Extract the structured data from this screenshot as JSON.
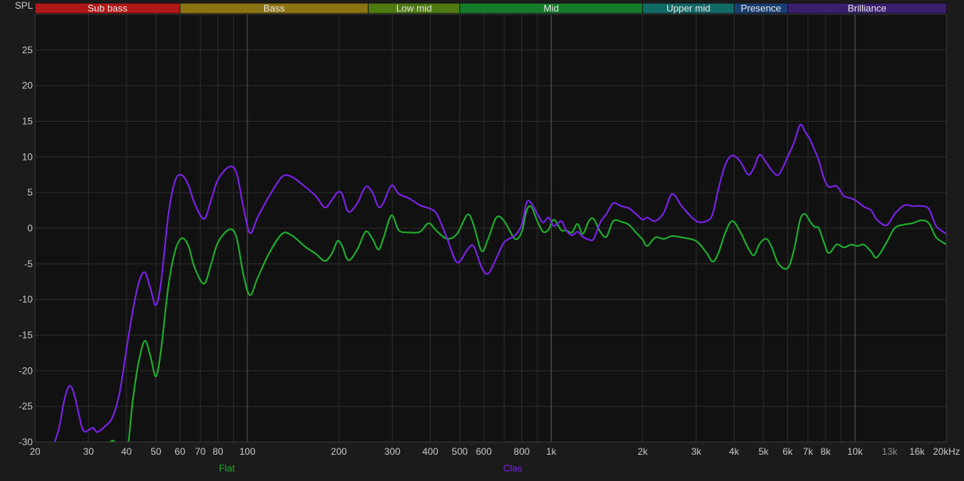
{
  "chart_data": {
    "type": "line",
    "title": "",
    "ylabel": "SPL",
    "xlabel": "",
    "x_scale": "log",
    "xlim": [
      20,
      20000
    ],
    "ylim": [
      -30,
      30
    ],
    "grid": true,
    "colors": {
      "background": "#1b1b1b",
      "plot_background": "#111111",
      "grid": "#2c2c2c",
      "major_grid": "#555555",
      "axis_text": "#c8c8c8",
      "muted_text": "#8a8a8a"
    },
    "yticks": [
      {
        "value": 25,
        "label": "25"
      },
      {
        "value": 20,
        "label": "20"
      },
      {
        "value": 15,
        "label": "15"
      },
      {
        "value": 10,
        "label": "10"
      },
      {
        "value": 5,
        "label": "5"
      },
      {
        "value": 0,
        "label": "0"
      },
      {
        "value": -5,
        "label": "-5"
      },
      {
        "value": -10,
        "label": "-10"
      },
      {
        "value": -15,
        "label": "-15"
      },
      {
        "value": -20,
        "label": "-20"
      },
      {
        "value": -25,
        "label": "-25"
      },
      {
        "value": -30,
        "label": "-30"
      }
    ],
    "xticks": [
      {
        "value": 20,
        "label": "20",
        "muted": false
      },
      {
        "value": 30,
        "label": "30",
        "muted": false
      },
      {
        "value": 40,
        "label": "40",
        "muted": false
      },
      {
        "value": 50,
        "label": "50",
        "muted": false
      },
      {
        "value": 60,
        "label": "60",
        "muted": false
      },
      {
        "value": 70,
        "label": "70",
        "muted": false
      },
      {
        "value": 80,
        "label": "80",
        "muted": false
      },
      {
        "value": 100,
        "label": "100",
        "muted": false
      },
      {
        "value": 200,
        "label": "200",
        "muted": false
      },
      {
        "value": 300,
        "label": "300",
        "muted": false
      },
      {
        "value": 400,
        "label": "400",
        "muted": false
      },
      {
        "value": 500,
        "label": "500",
        "muted": false
      },
      {
        "value": 600,
        "label": "600",
        "muted": false
      },
      {
        "value": 800,
        "label": "800",
        "muted": false
      },
      {
        "value": 1000,
        "label": "1k",
        "muted": false
      },
      {
        "value": 2000,
        "label": "2k",
        "muted": false
      },
      {
        "value": 3000,
        "label": "3k",
        "muted": false
      },
      {
        "value": 4000,
        "label": "4k",
        "muted": false
      },
      {
        "value": 5000,
        "label": "5k",
        "muted": false
      },
      {
        "value": 6000,
        "label": "6k",
        "muted": false
      },
      {
        "value": 7000,
        "label": "7k",
        "muted": false
      },
      {
        "value": 8000,
        "label": "8k",
        "muted": false
      },
      {
        "value": 10000,
        "label": "10k",
        "muted": false
      },
      {
        "value": 13000,
        "label": "13k",
        "muted": true
      },
      {
        "value": 16000,
        "label": "16k",
        "muted": false
      },
      {
        "value": 20000,
        "label": "20kHz",
        "muted": false
      }
    ],
    "major_gridlines_x": [
      100,
      1000,
      10000
    ],
    "bands": [
      {
        "name": "Sub bass",
        "from": 20,
        "to": 60,
        "color": "#b01818"
      },
      {
        "name": "Bass",
        "from": 60,
        "to": 250,
        "color": "#8c7412"
      },
      {
        "name": "Low mid",
        "from": 250,
        "to": 500,
        "color": "#4f7a12"
      },
      {
        "name": "Mid",
        "from": 500,
        "to": 2000,
        "color": "#157a2a"
      },
      {
        "name": "Upper mid",
        "from": 2000,
        "to": 4000,
        "color": "#126a66"
      },
      {
        "name": "Presence",
        "from": 4000,
        "to": 6000,
        "color": "#1a3f72"
      },
      {
        "name": "Brilliance",
        "from": 6000,
        "to": 20000,
        "color": "#3a1f6e"
      }
    ],
    "series": [
      {
        "name": "Flat",
        "color": "#1fae2e",
        "points": [
          [
            34,
            -31
          ],
          [
            36,
            -29.8
          ],
          [
            38,
            -31
          ],
          [
            40,
            -32
          ],
          [
            42,
            -24
          ],
          [
            44,
            -18.5
          ],
          [
            46,
            -15.8
          ],
          [
            48,
            -18
          ],
          [
            50,
            -20.8
          ],
          [
            52,
            -17
          ],
          [
            55,
            -8
          ],
          [
            58,
            -3
          ],
          [
            61,
            -1.4
          ],
          [
            64,
            -2.5
          ],
          [
            67,
            -5.5
          ],
          [
            72,
            -7.8
          ],
          [
            76,
            -5
          ],
          [
            80,
            -2
          ],
          [
            87,
            -0.2
          ],
          [
            92,
            -1.2
          ],
          [
            97,
            -6.5
          ],
          [
            102,
            -9.4
          ],
          [
            108,
            -7
          ],
          [
            118,
            -3.5
          ],
          [
            130,
            -0.8
          ],
          [
            140,
            -1
          ],
          [
            155,
            -2.6
          ],
          [
            168,
            -3.6
          ],
          [
            180,
            -4.6
          ],
          [
            190,
            -3.5
          ],
          [
            198,
            -1.8
          ],
          [
            205,
            -2.5
          ],
          [
            215,
            -4.5
          ],
          [
            230,
            -3
          ],
          [
            245,
            -0.5
          ],
          [
            258,
            -1.5
          ],
          [
            270,
            -3
          ],
          [
            280,
            -1.5
          ],
          [
            298,
            1.8
          ],
          [
            315,
            -0.3
          ],
          [
            340,
            -0.6
          ],
          [
            370,
            -0.5
          ],
          [
            395,
            0.7
          ],
          [
            420,
            -0.4
          ],
          [
            455,
            -1.5
          ],
          [
            490,
            -0.8
          ],
          [
            530,
            1.9
          ],
          [
            555,
            0.5
          ],
          [
            590,
            -3.2
          ],
          [
            620,
            -1.5
          ],
          [
            660,
            1.5
          ],
          [
            700,
            1
          ],
          [
            760,
            -1.5
          ],
          [
            800,
            -0.5
          ],
          [
            830,
            2.5
          ],
          [
            860,
            3
          ],
          [
            900,
            1
          ],
          [
            940,
            -0.5
          ],
          [
            980,
            -0.2
          ],
          [
            1020,
            1.2
          ],
          [
            1080,
            -0.3
          ],
          [
            1120,
            -0.3
          ],
          [
            1170,
            -0.6
          ],
          [
            1220,
            0.6
          ],
          [
            1270,
            -0.8
          ],
          [
            1330,
            1
          ],
          [
            1380,
            1.3
          ],
          [
            1450,
            -0.5
          ],
          [
            1520,
            -1.2
          ],
          [
            1600,
            1
          ],
          [
            1700,
            0.9
          ],
          [
            1800,
            0.5
          ],
          [
            1900,
            -0.6
          ],
          [
            2000,
            -1.6
          ],
          [
            2070,
            -2.5
          ],
          [
            2200,
            -1.3
          ],
          [
            2350,
            -1.5
          ],
          [
            2500,
            -1.1
          ],
          [
            2700,
            -1.3
          ],
          [
            3000,
            -1.8
          ],
          [
            3250,
            -3.5
          ],
          [
            3400,
            -4.7
          ],
          [
            3550,
            -3.5
          ],
          [
            3750,
            -0.5
          ],
          [
            3950,
            1
          ],
          [
            4200,
            -0.6
          ],
          [
            4450,
            -2.8
          ],
          [
            4650,
            -3.8
          ],
          [
            4850,
            -2.2
          ],
          [
            5100,
            -1.5
          ],
          [
            5300,
            -2.5
          ],
          [
            5600,
            -5
          ],
          [
            6000,
            -5.6
          ],
          [
            6300,
            -3
          ],
          [
            6600,
            1.2
          ],
          [
            6850,
            2
          ],
          [
            7100,
            1
          ],
          [
            7350,
            0.2
          ],
          [
            7600,
            0
          ],
          [
            7900,
            -2
          ],
          [
            8200,
            -3.5
          ],
          [
            8700,
            -2.3
          ],
          [
            9200,
            -2.7
          ],
          [
            9700,
            -2.3
          ],
          [
            10200,
            -2.5
          ],
          [
            10700,
            -2.3
          ],
          [
            11300,
            -3.3
          ],
          [
            11800,
            -4.1
          ],
          [
            12700,
            -2
          ],
          [
            13500,
            0
          ],
          [
            14500,
            0.5
          ],
          [
            15500,
            0.7
          ],
          [
            16500,
            1.1
          ],
          [
            17500,
            0.7
          ],
          [
            18500,
            -1.3
          ],
          [
            20000,
            -2.3
          ]
        ]
      },
      {
        "name": "Clas",
        "color": "#7a22e8",
        "points": [
          [
            23,
            -30.5
          ],
          [
            24,
            -28
          ],
          [
            25,
            -24
          ],
          [
            26,
            -22.1
          ],
          [
            27,
            -23.5
          ],
          [
            28,
            -26.5
          ],
          [
            29,
            -28.5
          ],
          [
            31,
            -28
          ],
          [
            32,
            -28.6
          ],
          [
            34,
            -27.8
          ],
          [
            36,
            -26.5
          ],
          [
            38,
            -23
          ],
          [
            40,
            -17
          ],
          [
            42,
            -11.5
          ],
          [
            44,
            -7.5
          ],
          [
            46,
            -6.2
          ],
          [
            48,
            -8.5
          ],
          [
            50,
            -10.8
          ],
          [
            52,
            -7.5
          ],
          [
            55,
            2
          ],
          [
            58,
            6.8
          ],
          [
            61,
            7.4
          ],
          [
            64,
            6
          ],
          [
            67,
            3.5
          ],
          [
            72,
            1.3
          ],
          [
            76,
            4
          ],
          [
            80,
            6.8
          ],
          [
            87,
            8.6
          ],
          [
            92,
            7.8
          ],
          [
            97,
            3
          ],
          [
            102,
            -0.7
          ],
          [
            108,
            1.5
          ],
          [
            118,
            4.5
          ],
          [
            130,
            7.2
          ],
          [
            140,
            7.2
          ],
          [
            155,
            5.8
          ],
          [
            168,
            4.5
          ],
          [
            180,
            2.9
          ],
          [
            190,
            4
          ],
          [
            198,
            5
          ],
          [
            205,
            4.8
          ],
          [
            215,
            2.3
          ],
          [
            230,
            3.5
          ],
          [
            245,
            5.8
          ],
          [
            258,
            5
          ],
          [
            270,
            3
          ],
          [
            280,
            3.5
          ],
          [
            298,
            6
          ],
          [
            315,
            4.8
          ],
          [
            340,
            4.2
          ],
          [
            370,
            3.2
          ],
          [
            395,
            2.8
          ],
          [
            420,
            2
          ],
          [
            455,
            -1.5
          ],
          [
            490,
            -4.8
          ],
          [
            530,
            -3
          ],
          [
            555,
            -2.5
          ],
          [
            590,
            -5.5
          ],
          [
            620,
            -6.4
          ],
          [
            660,
            -4.2
          ],
          [
            700,
            -2
          ],
          [
            760,
            -1
          ],
          [
            800,
            0.5
          ],
          [
            830,
            3.6
          ],
          [
            860,
            3.5
          ],
          [
            900,
            2
          ],
          [
            940,
            0.8
          ],
          [
            980,
            1.5
          ],
          [
            1020,
            0.3
          ],
          [
            1080,
            1
          ],
          [
            1120,
            -0.3
          ],
          [
            1170,
            -1
          ],
          [
            1220,
            -0.5
          ],
          [
            1270,
            -1.2
          ],
          [
            1330,
            -1.6
          ],
          [
            1380,
            -1.5
          ],
          [
            1450,
            0.8
          ],
          [
            1520,
            2
          ],
          [
            1600,
            3.5
          ],
          [
            1700,
            3.1
          ],
          [
            1800,
            2.8
          ],
          [
            1900,
            2
          ],
          [
            2000,
            1.2
          ],
          [
            2070,
            1.5
          ],
          [
            2200,
            1
          ],
          [
            2350,
            2.2
          ],
          [
            2500,
            4.8
          ],
          [
            2700,
            3
          ],
          [
            3000,
            1
          ],
          [
            3250,
            1
          ],
          [
            3400,
            2
          ],
          [
            3550,
            5.5
          ],
          [
            3750,
            9
          ],
          [
            3950,
            10.2
          ],
          [
            4200,
            9.3
          ],
          [
            4450,
            7.5
          ],
          [
            4650,
            8.5
          ],
          [
            4850,
            10.3
          ],
          [
            5100,
            9.2
          ],
          [
            5300,
            8.2
          ],
          [
            5600,
            7.5
          ],
          [
            6000,
            10
          ],
          [
            6300,
            12
          ],
          [
            6600,
            14.5
          ],
          [
            6850,
            13.5
          ],
          [
            7100,
            12.5
          ],
          [
            7350,
            11
          ],
          [
            7600,
            9.5
          ],
          [
            7900,
            7
          ],
          [
            8200,
            5.8
          ],
          [
            8700,
            5.9
          ],
          [
            9200,
            4.5
          ],
          [
            9700,
            4.2
          ],
          [
            10200,
            3.7
          ],
          [
            10700,
            3
          ],
          [
            11300,
            2.5
          ],
          [
            11800,
            1.2
          ],
          [
            12700,
            0.4
          ],
          [
            13500,
            2
          ],
          [
            14500,
            3.2
          ],
          [
            15500,
            3.1
          ],
          [
            16500,
            3.1
          ],
          [
            17500,
            2.7
          ],
          [
            18500,
            0.3
          ],
          [
            20000,
            -0.8
          ]
        ]
      }
    ]
  }
}
